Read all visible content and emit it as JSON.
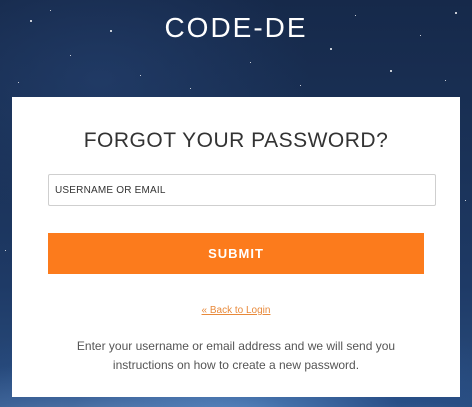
{
  "brand": {
    "logo_text": "CODE-DE"
  },
  "form": {
    "title": "FORGOT YOUR PASSWORD?",
    "username_placeholder": "USERNAME OR EMAIL",
    "username_value": "",
    "submit_label": "SUBMIT",
    "back_link_label": "« Back to Login",
    "info_text": "Enter your username or email address and we will send you instructions on how to create a new password."
  },
  "colors": {
    "accent": "#fc7b1c",
    "link": "#e8893a",
    "background": "#1a3258"
  }
}
